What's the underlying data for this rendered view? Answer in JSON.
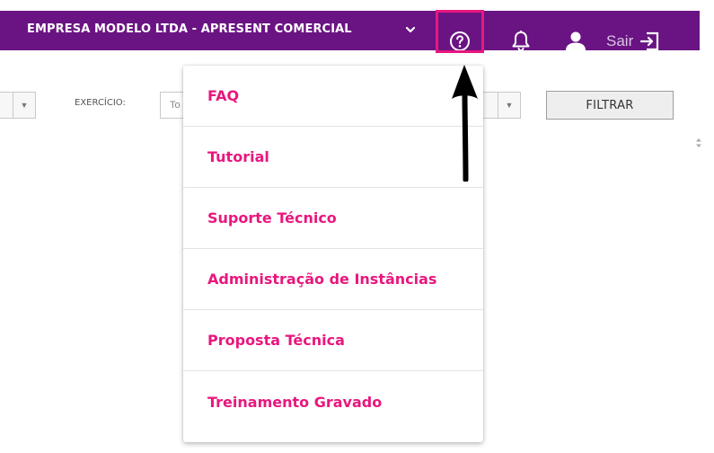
{
  "header": {
    "company": "EMPRESA MODELO LTDA - APRESENT COMERCIAL",
    "logout_label": "Sair",
    "background_color": "#6a1483",
    "icons": {
      "chevron": "chevron-down-icon",
      "help": "question-circle-icon",
      "notifications": "bell-icon",
      "user": "user-icon",
      "logout": "sign-out-icon"
    },
    "highlight_color": "#e8177e"
  },
  "filters": {
    "exercicio_label": "EXERCÍCIO:",
    "exercicio_value": "To",
    "filter_button": "FILTRAR"
  },
  "help_menu": {
    "accent_color": "#e8177e",
    "items": [
      "FAQ",
      "Tutorial",
      "Suporte Técnico",
      "Administração de Instâncias",
      "Proposta Técnica",
      "Treinamento Gravado"
    ]
  }
}
